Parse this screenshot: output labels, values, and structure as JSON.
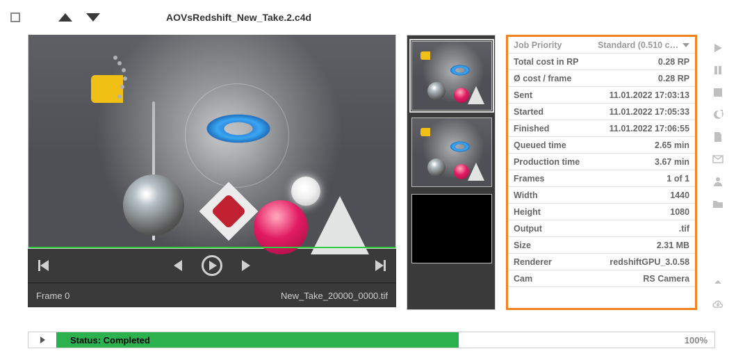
{
  "header": {
    "filename": "AOVsRedshift_New_Take.2.c4d"
  },
  "preview": {
    "frame_label": "Frame 0",
    "output_file": "New_Take_20000_0000.tif"
  },
  "details": {
    "priority_label": "Job Priority",
    "priority_value": "Standard (0.510 c…",
    "rows": [
      {
        "k": "Total cost in RP",
        "v": "0.28 RP"
      },
      {
        "k": "Ø cost / frame",
        "v": "0.28 RP"
      },
      {
        "k": "Sent",
        "v": "11.01.2022 17:03:13"
      },
      {
        "k": "Started",
        "v": "11.01.2022 17:05:33"
      },
      {
        "k": "Finished",
        "v": "11.01.2022 17:06:55"
      },
      {
        "k": "Queued time",
        "v": "2.65 min"
      },
      {
        "k": "Production time",
        "v": "3.67 min"
      },
      {
        "k": "Frames",
        "v": "1 of 1"
      },
      {
        "k": "Width",
        "v": "1440"
      },
      {
        "k": "Height",
        "v": "1080"
      },
      {
        "k": "Output",
        "v": ".tif"
      },
      {
        "k": "Size",
        "v": "2.31 MB"
      },
      {
        "k": "Renderer",
        "v": "redshiftGPU_3.0.58"
      },
      {
        "k": "Cam",
        "v": "RS Camera"
      }
    ]
  },
  "status": {
    "text": "Status: Completed",
    "percent": "100%"
  }
}
